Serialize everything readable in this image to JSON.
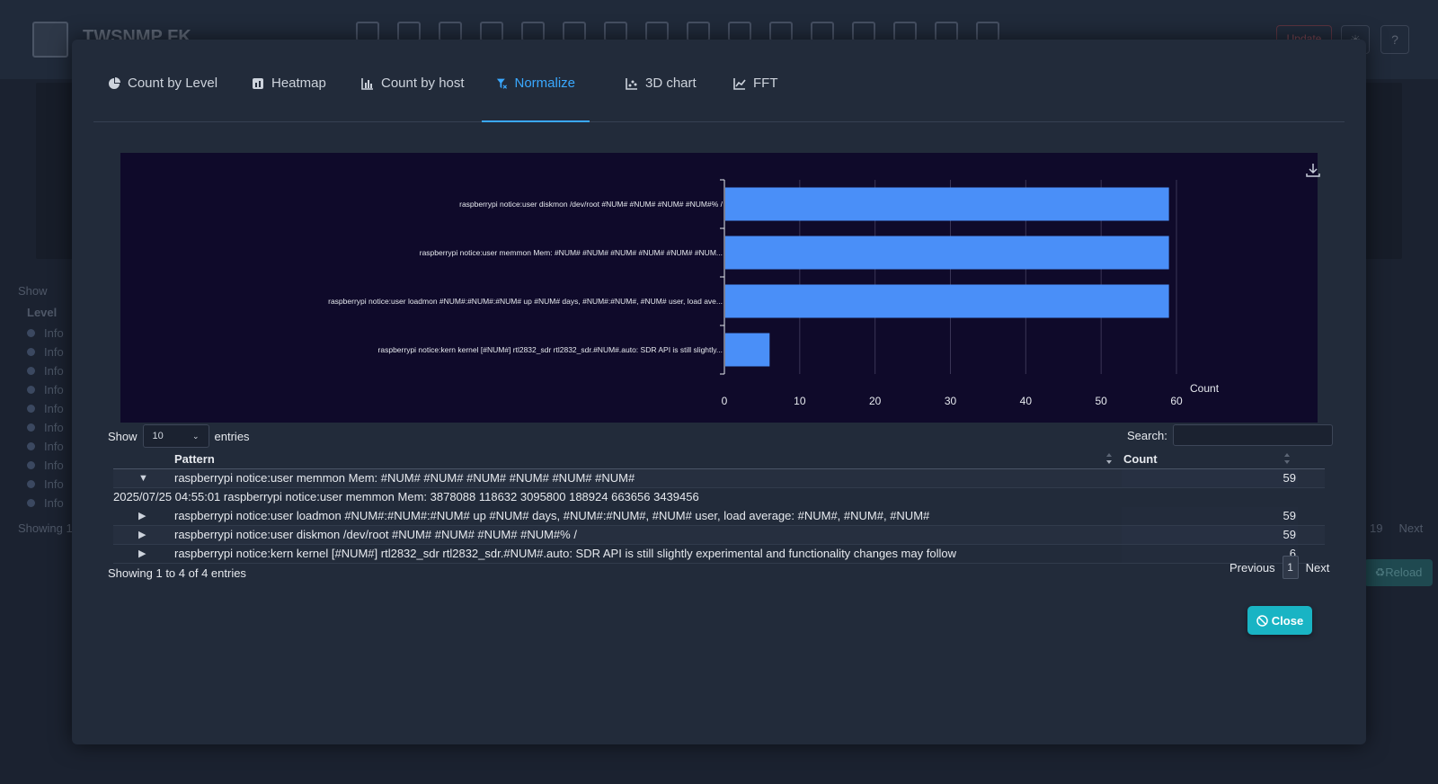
{
  "app": {
    "title": "TWSNMP FK",
    "update_label": "Update",
    "help_label": "?",
    "bg_show_label": "Show",
    "bg_show_value": "10",
    "bg_level_header": "Level",
    "bg_rows": [
      "Info",
      "Info",
      "Info",
      "Info",
      "Info",
      "Info",
      "Info",
      "Info",
      "Info",
      "Info"
    ],
    "bg_showing": "Showing 1",
    "bg_page": "19",
    "bg_next": "Next",
    "bg_reload": "Reload"
  },
  "tabs": [
    {
      "label": "Count by Level",
      "icon": "pie-chart-icon",
      "active": false
    },
    {
      "label": "Heatmap",
      "icon": "heatmap-icon",
      "active": false
    },
    {
      "label": "Count by host",
      "icon": "bar-chart-icon",
      "active": false
    },
    {
      "label": "Normalize",
      "icon": "filter-icon",
      "active": true
    },
    {
      "label": "3D chart",
      "icon": "scatter-chart-icon",
      "active": false
    },
    {
      "label": "FFT",
      "icon": "line-chart-icon",
      "active": false
    }
  ],
  "chart_data": {
    "type": "bar",
    "orientation": "horizontal",
    "categories": [
      "raspberrypi notice:user diskmon /dev/root       #NUM# #NUM# #NUM#   #NUM#% /",
      "raspberrypi notice:user memmon Mem:     #NUM#     #NUM#     #NUM#     #NUM#     #NUM#     #NUM...",
      "raspberrypi notice:user loadmon #NUM#:#NUM#:#NUM# up #NUM# days, #NUM#:#NUM#,  #NUM# user,  load ave...",
      "raspberrypi notice:kern kernel [#NUM#] rtl2832_sdr rtl2832_sdr.#NUM#.auto: SDR API is still slightly..."
    ],
    "values": [
      59,
      59,
      59,
      6
    ],
    "xlabel": "Count",
    "xlim": [
      0,
      60
    ],
    "xticks": [
      0,
      10,
      20,
      30,
      40,
      50,
      60
    ],
    "bar_color": "#4a8ff8",
    "background": "#0f0a2a",
    "grid": true
  },
  "table": {
    "show_label": "Show",
    "entries_label": "entries",
    "page_size": "10",
    "search_label": "Search:",
    "search_value": "",
    "headers": {
      "pattern": "Pattern",
      "count": "Count"
    },
    "rows": [
      {
        "toggle": "▼",
        "pattern": "raspberrypi notice:user memmon Mem: #NUM# #NUM# #NUM# #NUM# #NUM# #NUM#",
        "count": "59",
        "expanded": true,
        "detail": "2025/07/25 04:55:01 raspberrypi notice:user memmon Mem: 3878088 118632 3095800 188924 663656 3439456"
      },
      {
        "toggle": "▶",
        "pattern": "raspberrypi notice:user loadmon #NUM#:#NUM#:#NUM# up #NUM# days, #NUM#:#NUM#, #NUM# user, load average: #NUM#, #NUM#, #NUM#",
        "count": "59"
      },
      {
        "toggle": "▶",
        "pattern": "raspberrypi notice:user diskmon /dev/root #NUM# #NUM# #NUM# #NUM#% /",
        "count": "59"
      },
      {
        "toggle": "▶",
        "pattern": "raspberrypi notice:kern kernel [#NUM#] rtl2832_sdr rtl2832_sdr.#NUM#.auto: SDR API is still slightly experimental and functionality changes may follow",
        "count": "6"
      }
    ],
    "showing": "Showing 1 to 4 of 4 entries",
    "previous_label": "Previous",
    "current_page": "1",
    "next_label": "Next"
  },
  "close_label": "Close",
  "colors": {
    "accent": "#3aa8ff",
    "close": "#19b4c4",
    "bar": "#4a8ff8"
  }
}
